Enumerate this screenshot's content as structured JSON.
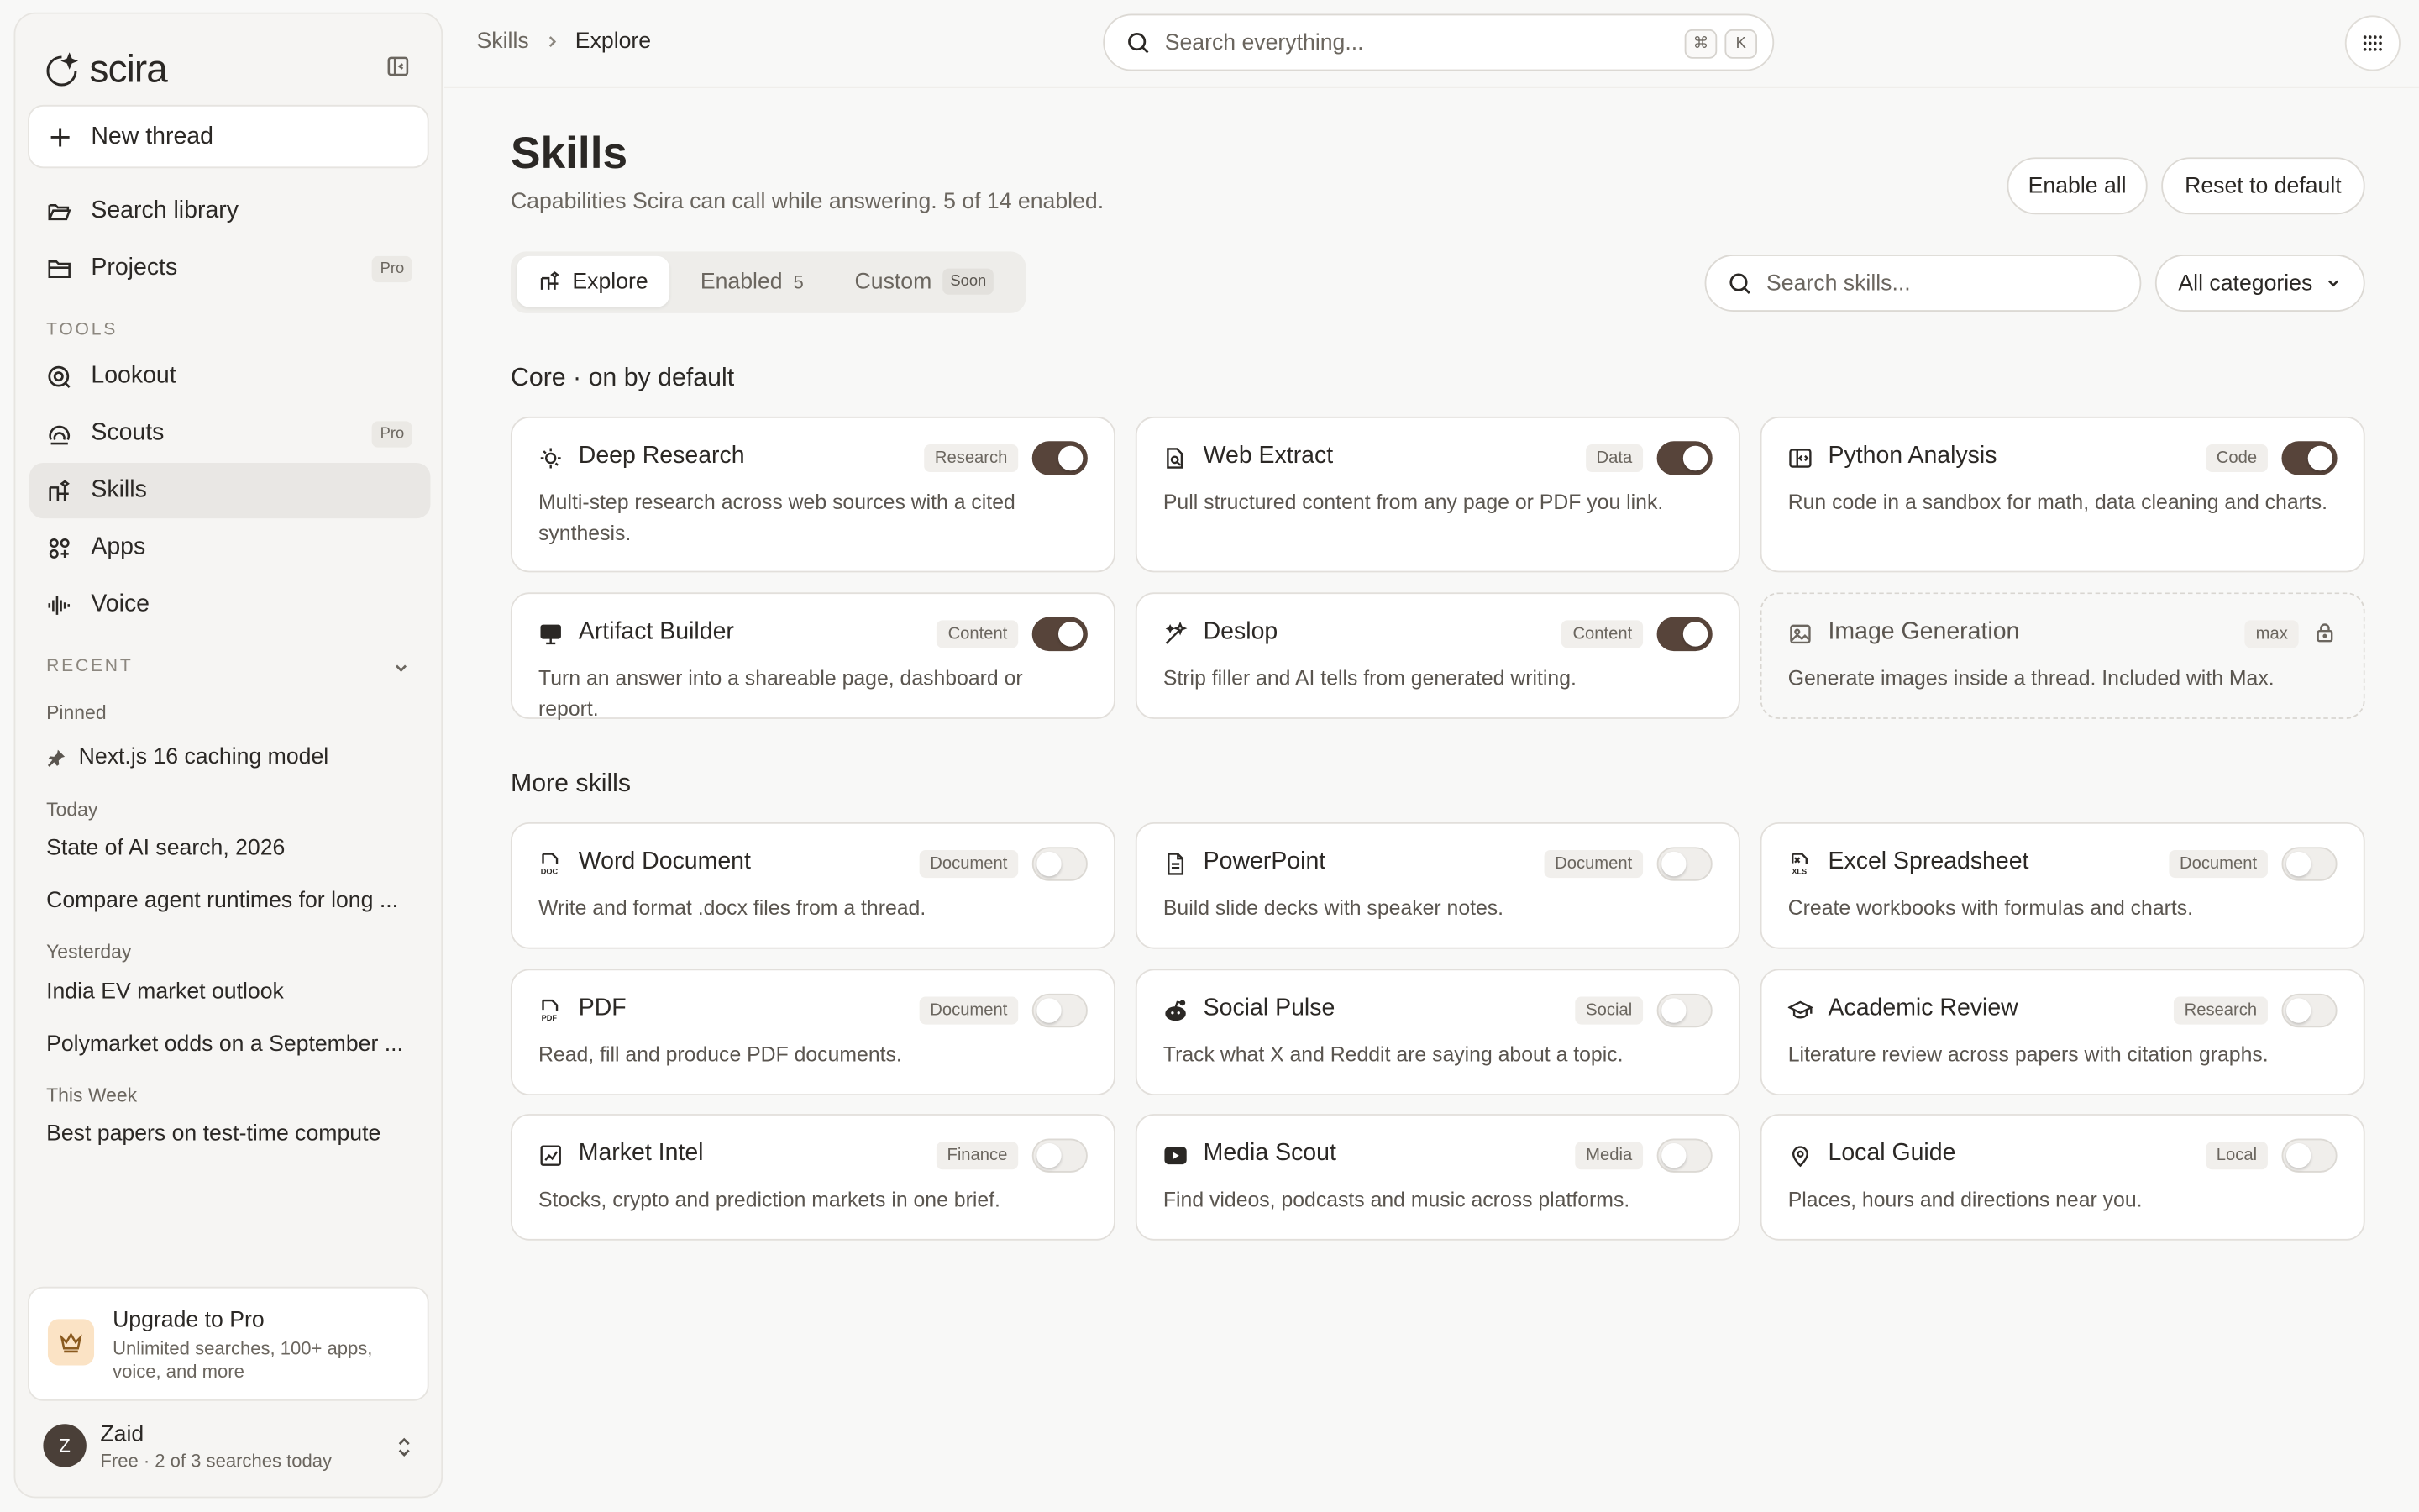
{
  "sidebar": {
    "brand": "scira",
    "new_thread": "New thread",
    "nav": [
      {
        "label": "Search library"
      },
      {
        "label": "Projects",
        "badge": "Pro"
      }
    ],
    "tools_label": "TOOLS",
    "tools": [
      {
        "label": "Lookout"
      },
      {
        "label": "Scouts",
        "badge": "Pro"
      },
      {
        "label": "Skills"
      },
      {
        "label": "Apps"
      },
      {
        "label": "Voice"
      }
    ],
    "recent_label": "RECENT",
    "pinned_label": "Pinned",
    "pinned": [
      "Next.js 16 caching model"
    ],
    "today_label": "Today",
    "today": [
      "State of AI search, 2026",
      "Compare agent runtimes for long ..."
    ],
    "yesterday_label": "Yesterday",
    "yesterday": [
      "India EV market outlook",
      "Polymarket odds on a September ..."
    ],
    "week_label": "This Week",
    "week": [
      "Best papers on test-time compute"
    ],
    "upgrade": {
      "title": "Upgrade to Pro",
      "subtitle": "Unlimited searches, 100+ apps, voice, and more"
    },
    "user": {
      "initial": "Z",
      "name": "Zaid",
      "plan": "Free · 2 of 3 searches today"
    }
  },
  "topbar": {
    "crumb_parent": "Skills",
    "crumb_current": "Explore",
    "search_placeholder": "Search everything...",
    "kbd1": "⌘",
    "kbd2": "K"
  },
  "page": {
    "title": "Skills",
    "subtitle": "Capabilities Scira can call while answering. 5 of 14 enabled.",
    "enable_all": "Enable all",
    "reset": "Reset to default",
    "tabs": {
      "explore": "Explore",
      "enabled": "Enabled",
      "enabled_count": "5",
      "custom": "Custom",
      "custom_badge": "Soon"
    },
    "skill_search_placeholder": "Search skills...",
    "category": "All categories",
    "core_heading": "Core · on by default",
    "more_heading": "More skills"
  },
  "core": [
    {
      "name": "Deep Research",
      "tag": "Research",
      "desc": "Multi-step research across web sources with a cited synthesis.",
      "on": true,
      "icon": "research-icon"
    },
    {
      "name": "Web Extract",
      "tag": "Data",
      "desc": "Pull structured content from any page or PDF you link.",
      "on": true,
      "icon": "extract-icon"
    },
    {
      "name": "Python Analysis",
      "tag": "Code",
      "desc": "Run code in a sandbox for math, data cleaning and charts.",
      "on": true,
      "icon": "code-icon"
    },
    {
      "name": "Artifact Builder",
      "tag": "Content",
      "desc": "Turn an answer into a shareable page, dashboard or report.",
      "on": true,
      "icon": "artifact-icon"
    },
    {
      "name": "Deslop",
      "tag": "Content",
      "desc": "Strip filler and AI tells from generated writing.",
      "on": true,
      "icon": "wand-icon"
    },
    {
      "name": "Image Generation",
      "tag": "max",
      "desc": "Generate images inside a thread. Included with Max.",
      "locked": true,
      "icon": "image-icon"
    }
  ],
  "more": [
    {
      "name": "Word Document",
      "tag": "Document",
      "desc": "Write and format .docx files from a thread.",
      "on": false,
      "icon": "doc-icon"
    },
    {
      "name": "PowerPoint",
      "tag": "Document",
      "desc": "Build slide decks with speaker notes.",
      "on": false,
      "icon": "file-icon"
    },
    {
      "name": "Excel Spreadsheet",
      "tag": "Document",
      "desc": "Create workbooks with formulas and charts.",
      "on": false,
      "icon": "xls-icon"
    },
    {
      "name": "PDF",
      "tag": "Document",
      "desc": "Read, fill and produce PDF documents.",
      "on": false,
      "icon": "pdf-icon"
    },
    {
      "name": "Social Pulse",
      "tag": "Social",
      "desc": "Track what X and Reddit are saying about a topic.",
      "on": false,
      "icon": "reddit-icon"
    },
    {
      "name": "Academic Review",
      "tag": "Research",
      "desc": "Literature review across papers with citation graphs.",
      "on": false,
      "icon": "graduation-cap-icon"
    },
    {
      "name": "Market Intel",
      "tag": "Finance",
      "desc": "Stocks, crypto and prediction markets in one brief.",
      "on": false,
      "icon": "chart-icon"
    },
    {
      "name": "Media Scout",
      "tag": "Media",
      "desc": "Find videos, podcasts and music across platforms.",
      "on": false,
      "icon": "play-icon"
    },
    {
      "name": "Local Guide",
      "tag": "Local",
      "desc": "Places, hours and directions near you.",
      "on": false,
      "icon": "map-pin-icon"
    }
  ]
}
